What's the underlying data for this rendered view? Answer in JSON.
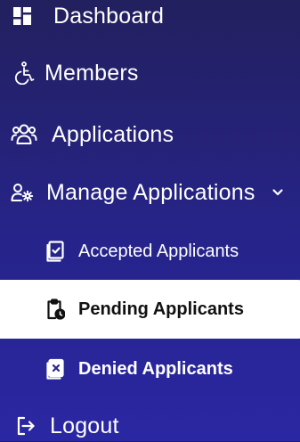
{
  "sidebar": {
    "items": [
      {
        "key": "dashboard",
        "label": "Dashboard",
        "icon": "dashboard-icon"
      },
      {
        "key": "members",
        "label": "Members",
        "icon": "wheelchair-icon"
      },
      {
        "key": "applications",
        "label": "Applications",
        "icon": "users-icon"
      },
      {
        "key": "manage",
        "label": "Manage Applications",
        "icon": "user-gear-icon",
        "expanded": true,
        "chevron": "chevron-down-icon"
      }
    ],
    "subitems": [
      {
        "key": "accepted",
        "label": "Accepted Applicants",
        "icon": "clipboard-check-icon"
      },
      {
        "key": "pending",
        "label": "Pending Applicants",
        "icon": "clipboard-clock-icon",
        "active": true
      },
      {
        "key": "denied",
        "label": "Denied Applicants",
        "icon": "clipboard-x-icon"
      }
    ],
    "logout": {
      "label": "Logout",
      "icon": "logout-icon"
    }
  },
  "colors": {
    "background_top": "#23205f",
    "background_bottom": "#2a27a3",
    "active_background": "#ffffff",
    "active_text": "#111111",
    "text": "#ffffff"
  }
}
